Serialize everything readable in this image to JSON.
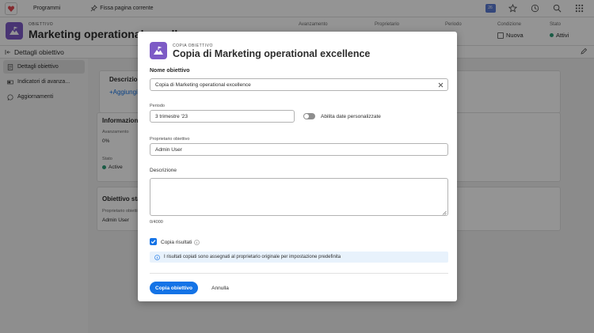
{
  "topbar": {
    "programs_label": "Programmi",
    "pin_label": "Fissa pagina corrente",
    "badge_text": "26"
  },
  "header": {
    "kicker": "OBIETTIVO",
    "title": "Marketing operational excellence",
    "meta": [
      {
        "label": "Avanzamento",
        "value": ""
      },
      {
        "label": "Proprietario",
        "value": ""
      },
      {
        "label": "Periodo",
        "value": ""
      },
      {
        "label": "Condizione",
        "value": "Nuova"
      },
      {
        "label": "Stato",
        "value": "Attivi"
      }
    ]
  },
  "subheader": {
    "title": "Dettagli obiettivo"
  },
  "sidebar": {
    "items": [
      {
        "label": "Dettagli obiettivo",
        "icon": "document-icon"
      },
      {
        "label": "Indicatori di avanza...",
        "icon": "progress-icon"
      },
      {
        "label": "Aggiornamenti",
        "icon": "comment-icon"
      }
    ]
  },
  "content": {
    "description_title": "Descrizion",
    "add_link": "+Aggiungi",
    "info_title": "Informazioni o",
    "progress_label": "Avanzamento",
    "progress_value": "0%",
    "status_label": "Stato",
    "status_value": "Active",
    "stakeholder_title": "Obiettivo stako",
    "owner_label": "Proprietario obietti",
    "owner_value": "Admin User"
  },
  "modal": {
    "kicker": "COPIA OBIETTIVO",
    "title": "Copia di Marketing operational excellence",
    "name_label": "Nome obiettivo",
    "name_value": "Copia di Marketing operational excellence",
    "period_label": "Periodo",
    "period_value": "3 trimestre '23",
    "custom_dates_label": "Abilita date personalizzate",
    "owner_label": "Proprietario obiettivo",
    "owner_value": "Admin User",
    "description_label": "Descrizione",
    "description_value": "",
    "char_counter": "0/4000",
    "copy_results_label": "Copia risultati",
    "copy_results_checked": true,
    "info_text": "I risultati copiati sono assegnati al proprietario originale per impostazione predefinita",
    "primary_button": "Copia obiettivo",
    "cancel_button": "Annulla"
  },
  "colors": {
    "accent": "#1473e6",
    "objective_purple": "#7d5bc6",
    "status_green": "#2d9d78",
    "info_bg": "#e8f2fc"
  }
}
